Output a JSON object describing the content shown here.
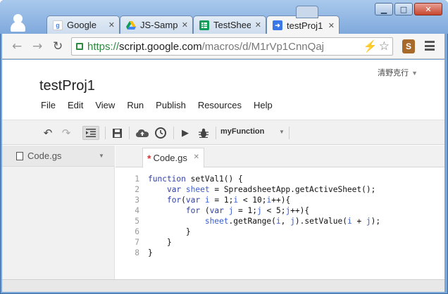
{
  "browser": {
    "tabs": [
      {
        "label": "Google",
        "icon": "google-g-icon",
        "color": "#4285f4"
      },
      {
        "label": "JS-Samp",
        "icon": "drive-icon",
        "color": "#0f9d58"
      },
      {
        "label": "TestShee",
        "icon": "sheets-icon",
        "color": "#0f9d58"
      },
      {
        "label": "testProj1",
        "icon": "apps-script-icon",
        "color": "#3b78e7"
      }
    ],
    "url_scheme": "https://",
    "url_host": "script.google.com",
    "url_path": "/macros/d/M1rVp1CnnQaj"
  },
  "app": {
    "user": "清野克行",
    "title": "testProj1",
    "menu": [
      "File",
      "Edit",
      "View",
      "Run",
      "Publish",
      "Resources",
      "Help"
    ],
    "function_select": "myFunction",
    "file_name": "Code.gs",
    "editor_tab": "Code.gs"
  },
  "code": {
    "lines": [
      {
        "n": "1",
        "t": "function setVal1() {"
      },
      {
        "n": "2",
        "t": "    var sheet = SpreadsheetApp.getActiveSheet();"
      },
      {
        "n": "3",
        "t": "    for(var i = 1;i < 10;i++){"
      },
      {
        "n": "4",
        "t": "        for (var j = 1;j < 5;j++){"
      },
      {
        "n": "5",
        "t": "            sheet.getRange(i, j).setValue(i + j);"
      },
      {
        "n": "6",
        "t": "        }"
      },
      {
        "n": "7",
        "t": "    }"
      },
      {
        "n": "8",
        "t": "}"
      }
    ]
  }
}
